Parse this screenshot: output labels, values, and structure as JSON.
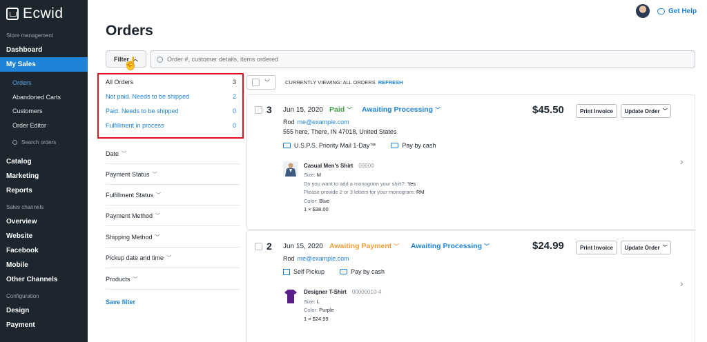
{
  "sidebar": {
    "logo": "Ecwid",
    "section_store": "Store management",
    "dashboard": "Dashboard",
    "my_sales": "My Sales",
    "sub_items": [
      "Orders",
      "Abandoned Carts",
      "Customers",
      "Order Editor"
    ],
    "search_placeholder": "Search orders",
    "catalog": "Catalog",
    "marketing": "Marketing",
    "reports": "Reports",
    "section_channels": "Sales channels",
    "overview": "Overview",
    "website": "Website",
    "facebook": "Facebook",
    "mobile": "Mobile",
    "other_channels": "Other Channels",
    "section_config": "Configuration",
    "design": "Design",
    "payment": "Payment"
  },
  "header": {
    "title": "Orders",
    "get_help": "Get Help"
  },
  "toolbar": {
    "filter_label": "Filter",
    "search_placeholder": "Order #, customer details, items ordered"
  },
  "filters": {
    "presets": [
      {
        "label": "All Orders",
        "count": "3"
      },
      {
        "label": "Not paid. Needs to be shipped",
        "count": "2"
      },
      {
        "label": "Paid. Needs to be shipped",
        "count": "0"
      },
      {
        "label": "Fulfillment in process",
        "count": "0"
      }
    ],
    "categories": [
      "Date",
      "Payment Status",
      "Fulfillment Status",
      "Payment Method",
      "Shipping Method",
      "Pickup date and time",
      "Products"
    ],
    "save_label": "Save filter"
  },
  "list": {
    "viewing_text": "CURRENTLY VIEWING: ALL ORDERS",
    "refresh_label": "REFRESH"
  },
  "colors": {
    "accent": "#1e82d6",
    "paid": "#43a047",
    "awaiting_payment": "#f29c38",
    "highlight_box": "#e1131e"
  },
  "orders": [
    {
      "number": "3",
      "date": "Jun 15, 2020",
      "payment_status": "Paid",
      "fulfillment_status": "Awaiting Processing",
      "total": "$45.50",
      "print_label": "Print Invoice",
      "update_label": "Update Order",
      "customer": "Rod",
      "email": "me@example.com",
      "address": "555 here, There, IN 47018, United States",
      "shipping": "U.S.P.S. Priority Mail 1-Day™",
      "payment": "Pay by cash",
      "product": {
        "name": "Casual Men's Shirt",
        "sku": "00000",
        "options": [
          {
            "label": "Size:",
            "value": "M"
          },
          {
            "label": "Do you want to add a monogram your shirt?:",
            "value": "Yes"
          },
          {
            "label": "Please provide 2 or 3 letters for your monogram:",
            "value": "RM"
          },
          {
            "label": "Color:",
            "value": "Blue"
          }
        ],
        "qty": "1 × $38.00"
      }
    },
    {
      "number": "2",
      "date": "Jun 15, 2020",
      "payment_status": "Awaiting Payment",
      "fulfillment_status": "Awaiting Processing",
      "total": "$24.99",
      "print_label": "Print Invoice",
      "update_label": "Update Order",
      "customer": "Rod",
      "email": "me@example.com",
      "shipping": "Self Pickup",
      "payment": "Pay by cash",
      "product": {
        "name": "Designer T-Shirt",
        "sku": "00000010-4",
        "options": [
          {
            "label": "Size:",
            "value": "L"
          },
          {
            "label": "Color:",
            "value": "Purple"
          }
        ],
        "qty": "1 × $24.99"
      }
    }
  ]
}
